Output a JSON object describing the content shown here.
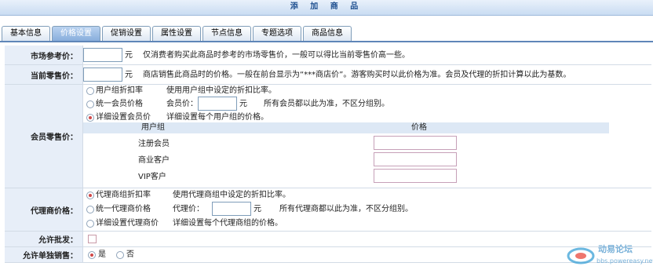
{
  "page": {
    "title": "添 加 商 品"
  },
  "tabs": [
    "基本信息",
    "价格设置",
    "促销设置",
    "属性设置",
    "节点信息",
    "专题选项",
    "商品信息"
  ],
  "market_price": {
    "label": "市场参考价：",
    "value": "",
    "unit": "元",
    "hint": "仅消费者购买此商品时参考的市场零售价，一般可以得比当前零售价高一些。"
  },
  "retail_price": {
    "label": "当前零售价：",
    "value": "",
    "unit": "元",
    "hint": "商店销售此商品时的价格。一般在前台显示为“***商店价”。游客购买时以此价格为准。会员及代理的折扣计算以此为基数。"
  },
  "member_price": {
    "label": "会员零售价：",
    "options": [
      {
        "label": "用户组折扣率",
        "desc": "使用用户组中设定的折扣比率。",
        "selected": false
      },
      {
        "label": "统一会员价格",
        "field_label": "会员价：",
        "unit": "元",
        "desc": "所有会员都以此为准，不区分组别。",
        "selected": false
      },
      {
        "label": "详细设置会员价",
        "desc": "详细设置每个用户组的价格。",
        "selected": true
      }
    ],
    "group_header": "用户组",
    "price_header": "价格",
    "groups": [
      {
        "name": "注册会员",
        "price": ""
      },
      {
        "name": "商业客户",
        "price": ""
      },
      {
        "name": "VIP客户",
        "price": ""
      }
    ]
  },
  "agent_price": {
    "label": "代理商价格：",
    "options": [
      {
        "label": "代理商组折扣率",
        "desc": "使用代理商组中设定的折扣比率。",
        "selected": true
      },
      {
        "label": "统一代理商价格",
        "field_label": "代理价：",
        "unit": "元",
        "desc": "所有代理商都以此为准，不区分组别。",
        "selected": false
      },
      {
        "label": "详细设置代理商价",
        "desc": "详细设置每个代理商组的价格。",
        "selected": false
      }
    ]
  },
  "wholesale": {
    "label": "允许批发：",
    "checked": false
  },
  "single_sale": {
    "label": "允许单独销售：",
    "options": [
      {
        "label": "是",
        "selected": true
      },
      {
        "label": "否",
        "selected": false
      }
    ]
  },
  "watermark": {
    "name": "动易论坛",
    "url": "bbs.powereasy.net"
  }
}
